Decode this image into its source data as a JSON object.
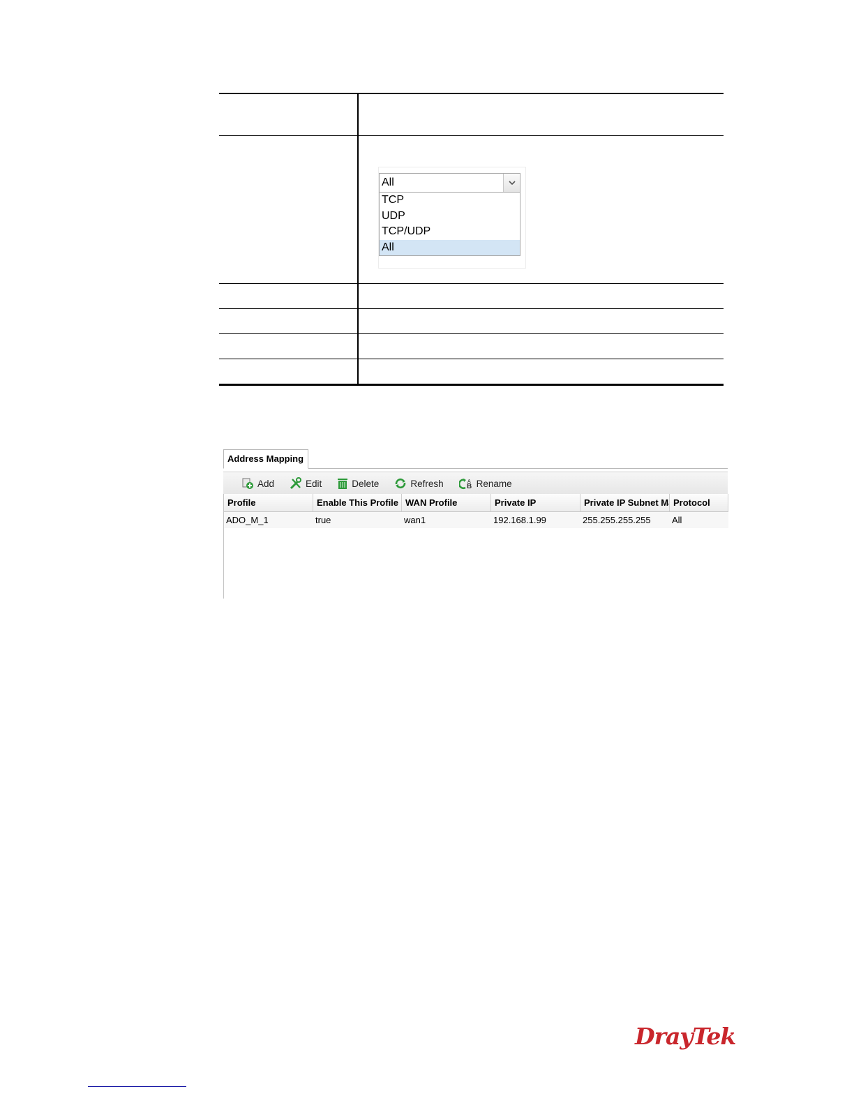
{
  "protocol_dropdown": {
    "selected": "All",
    "options": [
      "TCP",
      "UDP",
      "TCP/UDP",
      "All"
    ],
    "highlighted": "All"
  },
  "app": {
    "tab_label": "Address Mapping",
    "toolbar": {
      "add": "Add",
      "edit": "Edit",
      "delete": "Delete",
      "refresh": "Refresh",
      "rename": "Rename"
    },
    "columns": [
      "Profile",
      "Enable This Profile",
      "WAN Profile",
      "Private IP",
      "Private IP Subnet Mask",
      "Protocol"
    ],
    "rows": [
      [
        "ADO_M_1",
        "true",
        "wan1",
        "192.168.1.99",
        "255.255.255.255",
        "All"
      ]
    ]
  },
  "logo": "DrayTek",
  "colors": {
    "brand": "#c9262c",
    "selection": "#d3e5f5",
    "icon_green": "#2e9a3a"
  }
}
